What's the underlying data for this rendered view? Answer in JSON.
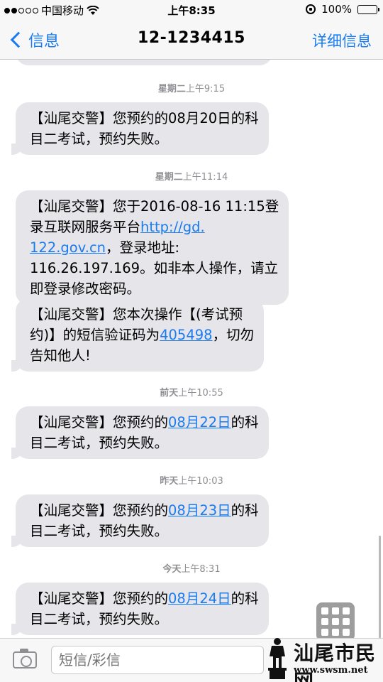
{
  "status_bar": {
    "carrier": "中国移动",
    "time": "上午8:35",
    "battery": "100%",
    "signal_bars": 2,
    "signal_total": 5
  },
  "nav": {
    "back_label": "信息",
    "title": "12-1234415",
    "detail_label": "详细信息"
  },
  "messages": [
    {
      "timestamp_day": "星期二",
      "timestamp_time": "上午9:15",
      "lines": [
        [
          "【汕尾交警】您预约的08月20日的科"
        ],
        [
          "目二考试，预约失败。"
        ]
      ]
    },
    {
      "timestamp_day": "星期二",
      "timestamp_time": "上午11:14",
      "lines": [
        [
          "【汕尾交警】您于2016-08-16 11:15登"
        ],
        [
          "录互联网服务平台",
          "http://gd."
        ],
        [
          "122.gov.cn",
          "，登录地址:"
        ],
        [
          "116.26.197.169。如非本人操作，请立"
        ],
        [
          "即登录修改密码。"
        ]
      ]
    },
    {
      "lines": [
        [
          "【汕尾交警】您本次操作【(考试预"
        ],
        [
          "约)】的短信验证码为",
          "405498",
          "，切勿"
        ],
        [
          "告知他人!"
        ]
      ]
    },
    {
      "timestamp_day": "前天",
      "timestamp_time": "上午10:55",
      "lines": [
        [
          "【汕尾交警】您预约的",
          "08月22日",
          "的科"
        ],
        [
          "目二考试，预约失败。"
        ]
      ]
    },
    {
      "timestamp_day": "昨天",
      "timestamp_time": "上午10:03",
      "lines": [
        [
          "【汕尾交警】您预约的",
          "08月23日",
          "的科"
        ],
        [
          "目二考试，预约失败。"
        ]
      ]
    },
    {
      "timestamp_day": "今天",
      "timestamp_time": "上午8:31",
      "lines": [
        [
          "【汕尾交警】您预约的",
          "08月24日",
          "的科"
        ],
        [
          "目二考试，预约失败。"
        ]
      ]
    }
  ],
  "input": {
    "placeholder": "短信/彩信"
  },
  "watermark": {
    "name": "汕尾市民网",
    "url": "www.swsm.net"
  },
  "colors": {
    "accent": "#1a7cf0",
    "bubble": "#e5e5ea",
    "timestamp": "#8e8e93"
  }
}
